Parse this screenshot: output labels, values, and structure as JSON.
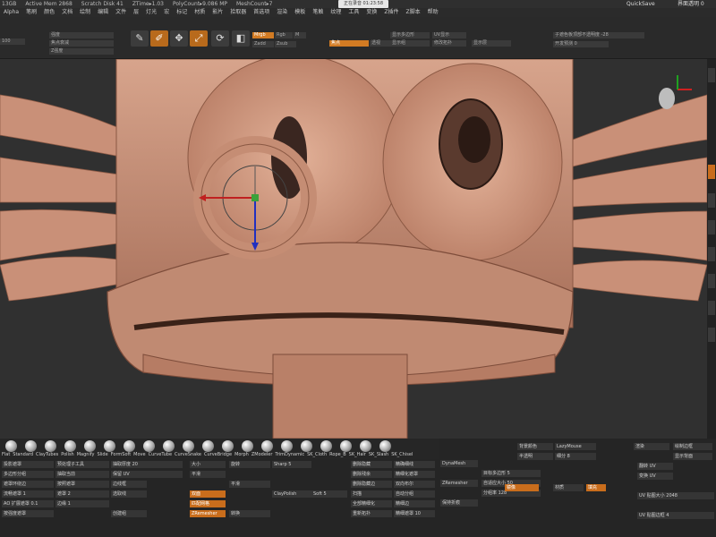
{
  "topbar": {
    "items": [
      "13GB",
      "Active Mem 2868",
      "Scratch Disk 41",
      "ZTime▸1.03",
      "PolyCount▸9.086 MP",
      "MeshCount▸7"
    ],
    "center_badge": "正在录音 01:23:58",
    "quicksave": "QuickSave",
    "right": "界面透明 0"
  },
  "menu": [
    "Alpha",
    "笔刷",
    "颜色",
    "文档",
    "绘制",
    "编辑",
    "文件",
    "层",
    "灯光",
    "宏",
    "标记",
    "材质",
    "影片",
    "拾取器",
    "首选项",
    "渲染",
    "模板",
    "笔触",
    "纹理",
    "工具",
    "变换",
    "Z插件",
    "Z脚本",
    "帮助"
  ],
  "toolbar": {
    "left_value": "100",
    "left_fields": [
      "强度",
      "焦点衰减",
      "Z强度",
      "绘制大小"
    ],
    "icons": [
      "edit-icon",
      "draw-icon",
      "move-icon",
      "scale-icon",
      "rotate-icon"
    ],
    "mrgb": "Mrgb",
    "rgb": "Rgb",
    "m": "M",
    "zadd": "Zadd",
    "zsub": "Zsub",
    "zcut": "Zcut",
    "focal": "焦点",
    "persp": "透视",
    "floor": "地面",
    "local": "本地",
    "xyz": "XYZ",
    "mid_fields": [
      "显示多边形",
      "显示组",
      "显示边框"
    ],
    "right_fields": [
      "UV显示",
      "修改拓扑",
      "显示层"
    ],
    "transp": "子遮色板顶部不透明度 -28",
    "ghost": "开发预测 0"
  },
  "viewport": {
    "bg": "#303030",
    "mesh": "#c08a72"
  },
  "brushes": [
    "Flat",
    "Standard",
    "ClayTubes",
    "Polish",
    "Magnify",
    "Slide",
    "FormSoft",
    "Move",
    "CurveTube",
    "CurveSnake",
    "CurveBridge",
    "Morph",
    "ZModeler",
    "TrimDynamic",
    "SK_Cloth",
    "Rope_B",
    "SK_Hair",
    "SK_Slash",
    "SK_Chisel"
  ],
  "panel": {
    "col1": [
      "投影遮罩",
      "多边形分组",
      "遮罩环绕边",
      "流畅遮罩 1",
      "AO 扩展遮罩 0.1",
      "按强度遮罩"
    ],
    "col2": [
      "预处理子工具",
      "抽取当前",
      "按照遮罩",
      "遮罩 2",
      "边缘 1"
    ],
    "col3": [
      "抽取厚度 20",
      "保留 UV",
      "边线框",
      "选取线",
      "创建组"
    ],
    "col4": [
      "大小",
      "平滑",
      "双面",
      "匹配网格",
      "ZRemesher"
    ],
    "col5": [
      "旋转",
      "平滑",
      "转换",
      "ClayPolish",
      "Sharp 5",
      "Soft 5"
    ],
    "col6": [
      "删除隐藏",
      "删除残余",
      "删除隐藏边",
      "扫描",
      "全部精细化",
      "重新拓扑"
    ],
    "col7": [
      "精确细线",
      "精细化遮罩",
      "双向布尔",
      "自动分组",
      "精细边",
      "精细遮罩 10"
    ],
    "col8": [
      "DynaMesh",
      "ZRemesher",
      "保持折痕",
      "目标多边形 5",
      "自适应大小 50",
      "分组率 128"
    ],
    "right": [
      "背景颜色",
      "半透明",
      "镜像",
      "LazyMouse",
      "细分 8",
      "填充",
      "材质",
      "渲染",
      "绘制边框",
      "显示背面",
      "翻转 UV",
      "变换 UV",
      "UV 贴图大小 2048",
      "UV 贴图边框 4"
    ]
  }
}
